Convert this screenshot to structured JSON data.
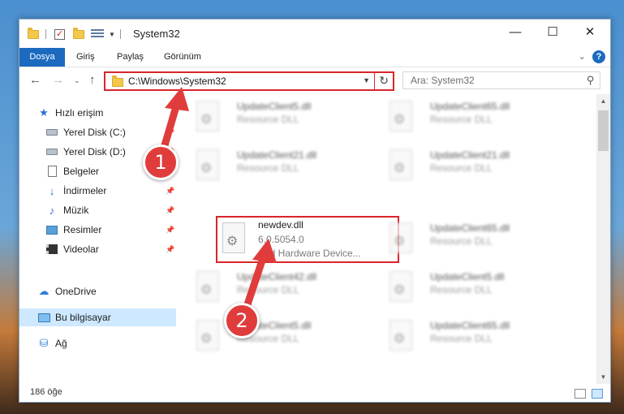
{
  "window": {
    "title": "System32",
    "minimize_glyph": "—",
    "maximize_glyph": "☐",
    "close_glyph": "✕"
  },
  "ribbon": {
    "tabs": [
      "Dosya",
      "Giriş",
      "Paylaş",
      "Görünüm"
    ],
    "help_glyph": "?"
  },
  "address": {
    "path": "C:\\Windows\\System32",
    "refresh_glyph": "↻"
  },
  "search": {
    "placeholder": "Ara: System32",
    "icon": "search-icon"
  },
  "nav": {
    "items": [
      {
        "label": "Hızlı erişim",
        "icon": "star-icon"
      },
      {
        "label": "Yerel Disk (C:)",
        "icon": "disk-icon"
      },
      {
        "label": "Yerel Disk (D:)",
        "icon": "disk-icon"
      },
      {
        "label": "Belgeler",
        "icon": "document-icon"
      },
      {
        "label": "İndirmeler",
        "icon": "download-icon"
      },
      {
        "label": "Müzik",
        "icon": "music-icon"
      },
      {
        "label": "Resimler",
        "icon": "picture-icon"
      },
      {
        "label": "Videolar",
        "icon": "video-icon"
      },
      {
        "label": "OneDrive",
        "icon": "cloud-icon"
      },
      {
        "label": "Bu bilgisayar",
        "icon": "computer-icon"
      },
      {
        "label": "Ağ",
        "icon": "network-icon"
      }
    ]
  },
  "files": [
    {
      "name": "UpdateClient5.dll",
      "line1": "Resource DLL",
      "line2": ""
    },
    {
      "name": "UpdateClient65.dll",
      "line1": "Resource DLL",
      "line2": ""
    },
    {
      "name": "UpdateClient21.dll",
      "line1": "Resource DLL",
      "line2": ""
    },
    {
      "name": "UpdateClient21.dll",
      "line1": "Resource DLL",
      "line2": ""
    },
    {
      "name": "newdev.dll",
      "line1": "6.0.5054.0",
      "line2": "Add Hardware Device..."
    },
    {
      "name": "UpdateClient65.dll",
      "line1": "Resource DLL",
      "line2": ""
    },
    {
      "name": "UpdateClient42.dll",
      "line1": "Resource DLL",
      "line2": ""
    },
    {
      "name": "UpdateClient5.dll",
      "line1": "Resource DLL",
      "line2": ""
    },
    {
      "name": "UpdateClient5.dll",
      "line1": "Resource DLL",
      "line2": ""
    },
    {
      "name": "UpdateClient65.dll",
      "line1": "Resource DLL",
      "line2": ""
    }
  ],
  "status": {
    "count": "186 öğe"
  },
  "annotations": {
    "badge1": "1",
    "badge2": "2",
    "color": "#e03c3c"
  }
}
